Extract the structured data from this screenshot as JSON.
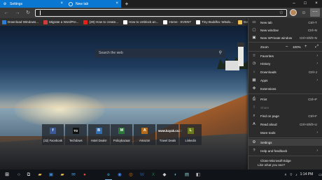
{
  "tabs": [
    {
      "label": "Settings",
      "icon": "gear-icon"
    },
    {
      "label": "New tab",
      "icon": "edge-icon"
    }
  ],
  "toolbar": {
    "address_value": ""
  },
  "favorites": [
    {
      "label": "Download Windows...",
      "color": "#2a7fd4"
    },
    {
      "label": "Migrate a WordPre...",
      "color": "#d23b3b"
    },
    {
      "label": "(29) How to create...",
      "color": "#e62117"
    },
    {
      "label": "How to Unblock an...",
      "color": "#ffffff"
    },
    {
      "label": "Home - EVENT",
      "color": "#ffffff"
    },
    {
      "label": "Tiny Buddha: Wisdo...",
      "color": "#ffffff"
    },
    {
      "label": "Geekerma",
      "color": "#f0c050"
    }
  ],
  "search": {
    "placeholder": "Search the web"
  },
  "quick_links": [
    {
      "label": "(32) Facebook",
      "logo": "f",
      "color": "#3b5998"
    },
    {
      "label": "Techdows",
      "logo": "TD",
      "color": "#111111"
    },
    {
      "label": "Hotel Deals!",
      "logo": "B",
      "color": "#2f6db5"
    },
    {
      "label": "Policybazaar",
      "logo": "M",
      "color": "#2b7a3a"
    },
    {
      "label": "Amazon",
      "logo": "A",
      "color": "#b36b1e"
    },
    {
      "label": "Travel Deals",
      "logo": "www.kayak.co.in",
      "color": "transparent"
    },
    {
      "label": "Linkedin",
      "logo": "L",
      "color": "#6b7a1e"
    }
  ],
  "menu": {
    "new_tab": {
      "label": "New tab",
      "shortcut": "Ctrl+T"
    },
    "new_window": {
      "label": "New window",
      "shortcut": "Ctrl+N"
    },
    "new_inprivate": {
      "label": "New InPrivate window",
      "shortcut": "Ctrl+Shift+N"
    },
    "zoom": {
      "label": "Zoom",
      "value": "100%"
    },
    "favorites": {
      "label": "Favorites"
    },
    "history": {
      "label": "History"
    },
    "downloads": {
      "label": "Downloads",
      "shortcut": "Ctrl+J"
    },
    "apps": {
      "label": "Apps"
    },
    "extensions": {
      "label": "Extensions"
    },
    "print": {
      "label": "Print",
      "shortcut": "Ctrl+P"
    },
    "share": {
      "label": "Share"
    },
    "find": {
      "label": "Find on page",
      "shortcut": "Ctrl+F"
    },
    "read_aloud": {
      "label": "Read aloud",
      "shortcut": "Ctrl+Shift+U"
    },
    "more_tools": {
      "label": "More tools"
    },
    "settings": {
      "label": "Settings"
    },
    "help": {
      "label": "Help and feedback"
    },
    "close": {
      "label": "Close Microsoft Edge"
    }
  },
  "peek_text": "Like what you see?",
  "taskbar": {
    "time": "1:14 PM"
  }
}
